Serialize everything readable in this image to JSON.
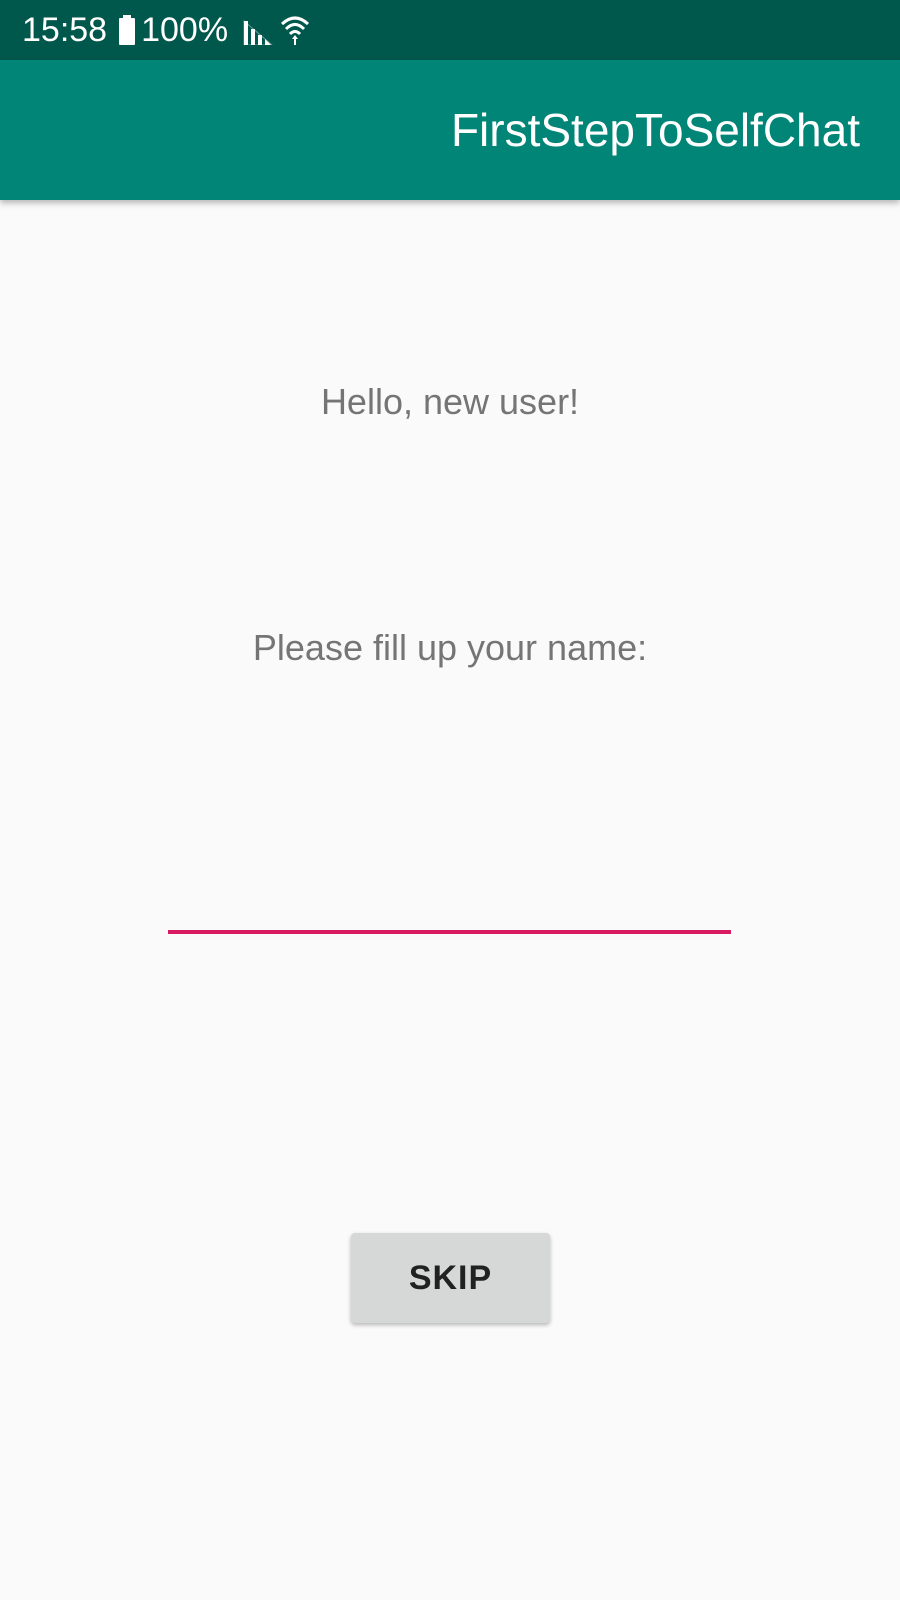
{
  "status_bar": {
    "time": "15:58",
    "battery_percent": "100%",
    "battery_icon": "battery-full-icon",
    "signal_icon": "signal-icon",
    "wifi_icon": "wifi-icon",
    "background_color": "#00574B"
  },
  "app_bar": {
    "title": "FirstStepToSelfChat",
    "background_color": "#008577"
  },
  "main": {
    "greeting": "Hello, new user!",
    "prompt": "Please fill up your name:",
    "name_input": {
      "value": "",
      "placeholder": "",
      "underline_color": "#D81B60"
    },
    "skip_button_label": "SKIP"
  }
}
